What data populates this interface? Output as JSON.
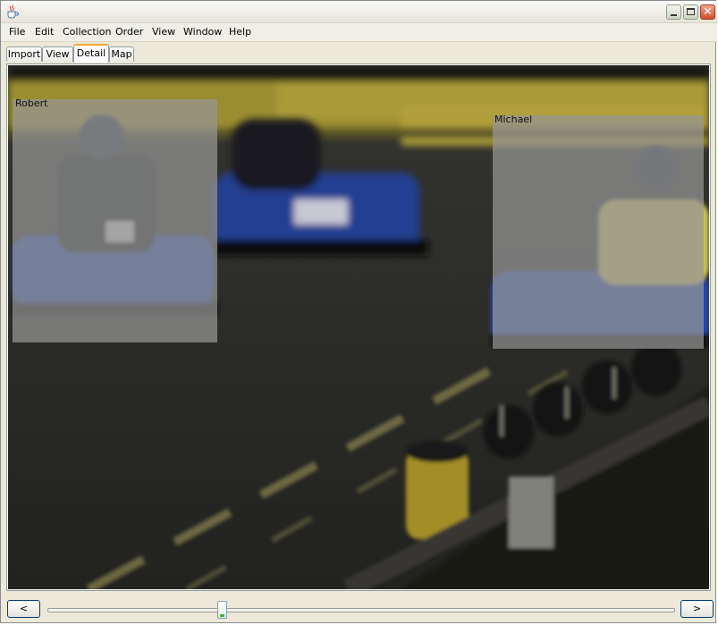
{
  "window": {
    "icon": "java-cup-icon",
    "controls": [
      "minimize-icon",
      "maximize-icon",
      "close-icon"
    ]
  },
  "menu": [
    "File",
    "Edit",
    "Collection",
    "Order",
    "View",
    "Window",
    "Help"
  ],
  "tabs": [
    {
      "label": "Import",
      "active": false
    },
    {
      "label": "View",
      "active": false
    },
    {
      "label": "Detail",
      "active": true
    },
    {
      "label": "Map",
      "active": false
    }
  ],
  "photo": {
    "description_icon": "go-kart-photo",
    "faces": [
      {
        "label": "Robert"
      },
      {
        "label": "Michael"
      }
    ]
  },
  "navigation": {
    "prev_label": "<",
    "next_label": ">",
    "slider_position": 0.28
  },
  "colors": {
    "active_tab_accent": "#f0a830",
    "face_box": "#969696"
  }
}
